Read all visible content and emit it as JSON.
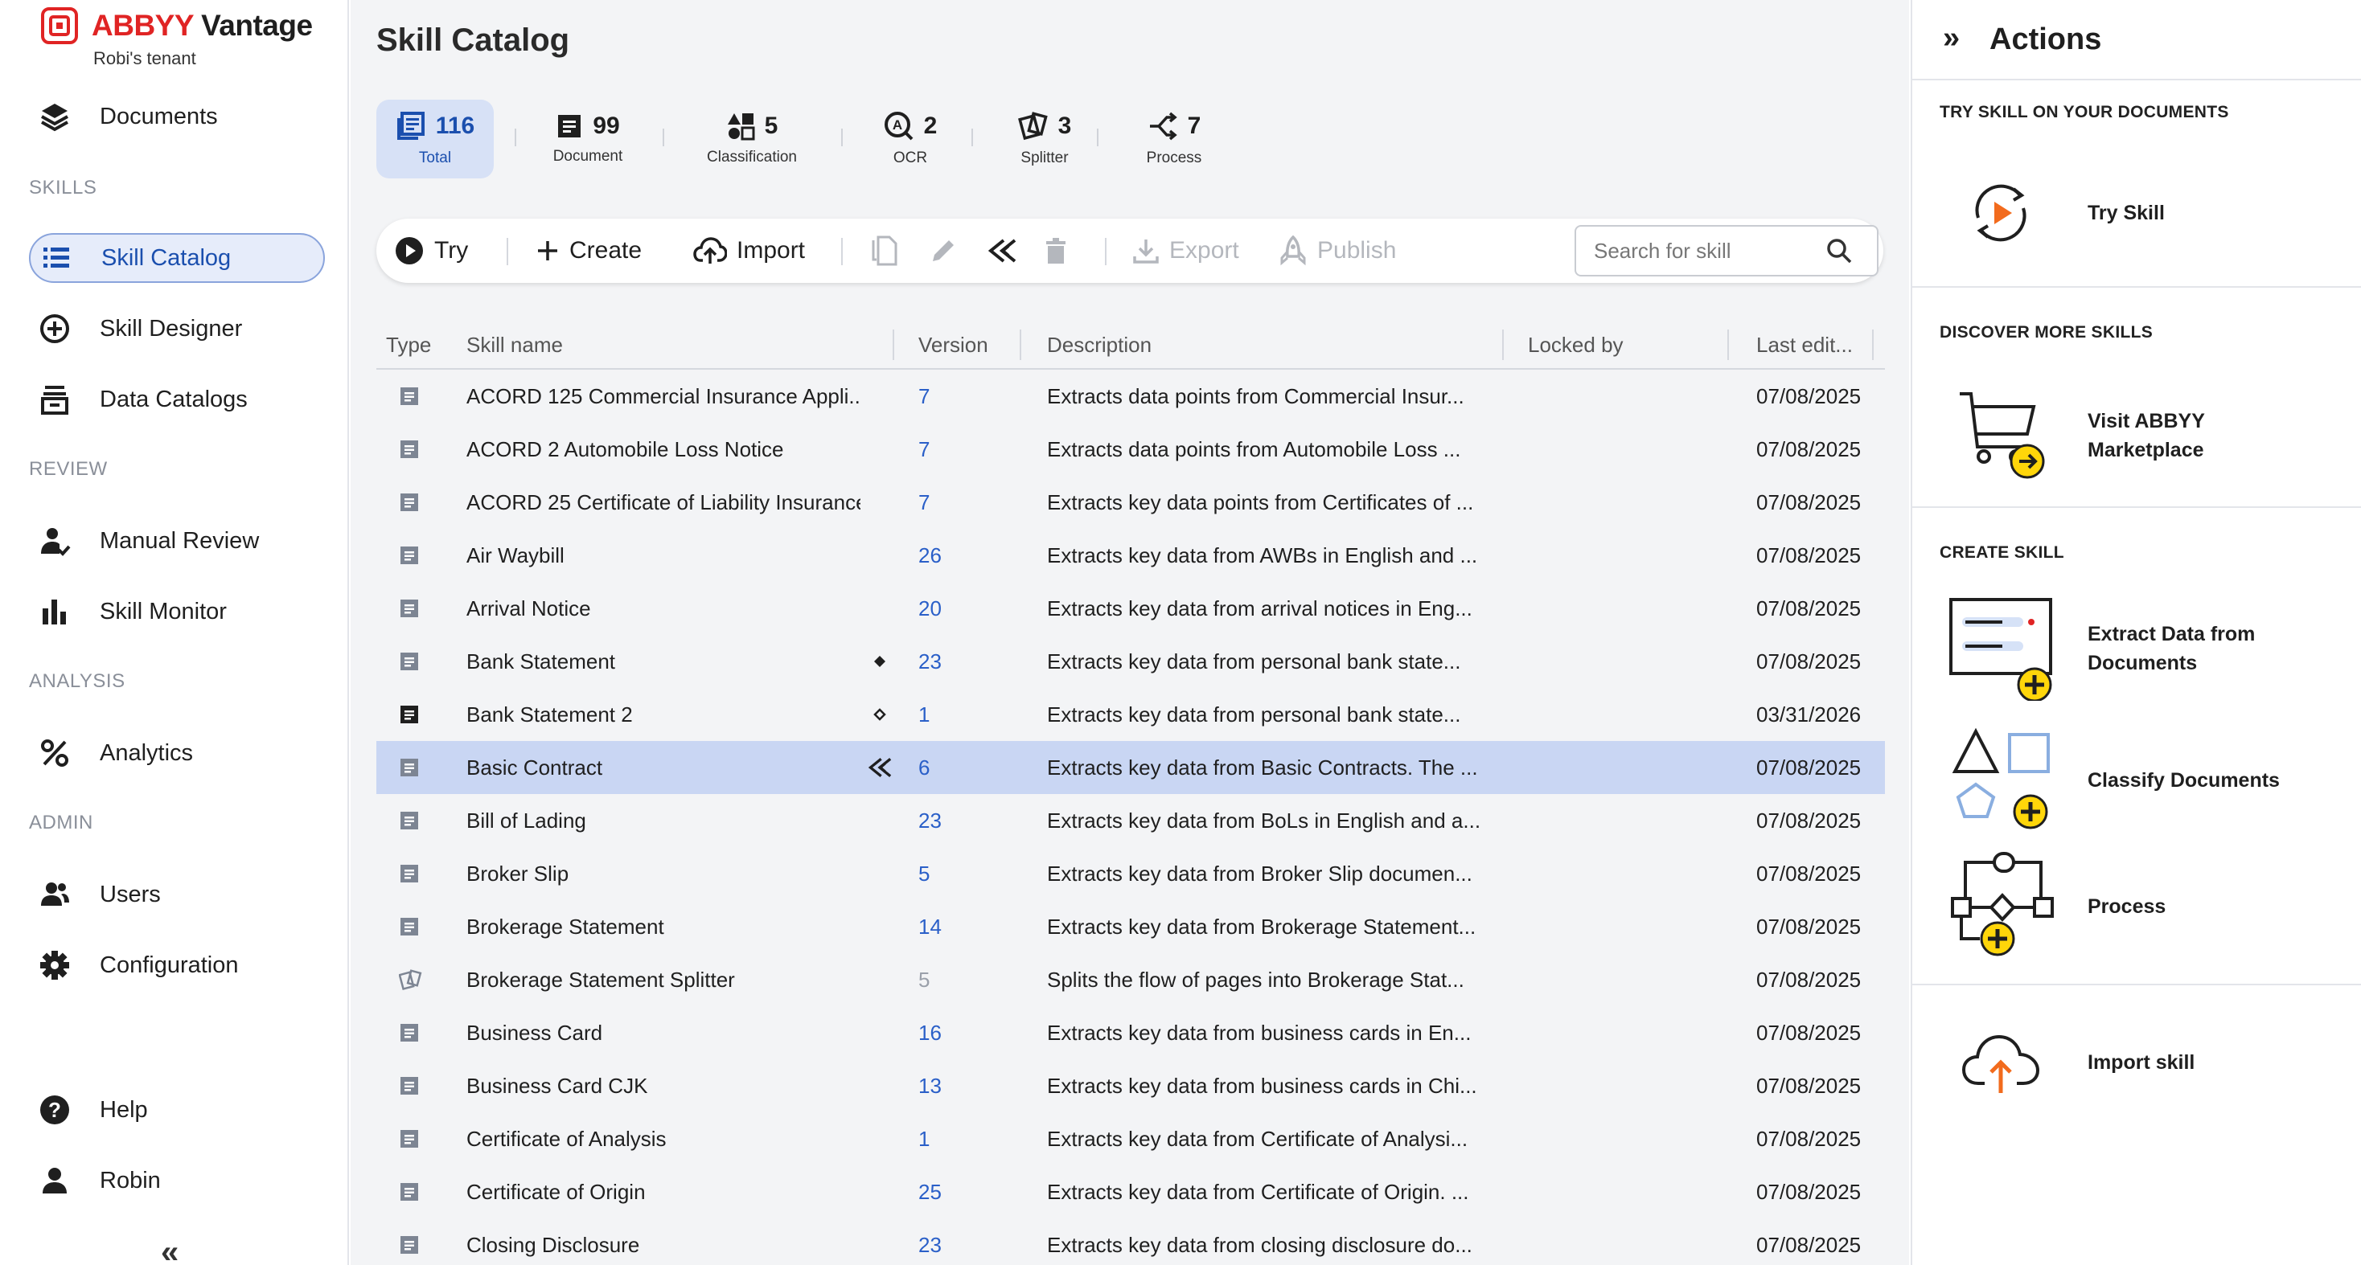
{
  "app": {
    "brand_part1": "ABBYY",
    "brand_part2": " Vantage",
    "tenant": "Robi's tenant",
    "brand_color": "#e02424",
    "accent_color": "#1b4fae"
  },
  "sidebar": {
    "documents": "Documents",
    "skills_section": "SKILLS",
    "skill_catalog": "Skill Catalog",
    "skill_designer": "Skill Designer",
    "data_catalogs": "Data Catalogs",
    "review_section": "REVIEW",
    "manual_review": "Manual Review",
    "skill_monitor": "Skill Monitor",
    "analysis_section": "ANALYSIS",
    "analytics": "Analytics",
    "admin_section": "ADMIN",
    "users": "Users",
    "configuration": "Configuration",
    "help": "Help",
    "user": "Robin",
    "collapse": "«"
  },
  "main": {
    "title": "Skill Catalog",
    "stats": [
      {
        "count": "116",
        "label": "Total",
        "icon": "catalog-icon"
      },
      {
        "count": "99",
        "label": "Document",
        "icon": "document-icon"
      },
      {
        "count": "5",
        "label": "Classification",
        "icon": "classification-icon"
      },
      {
        "count": "2",
        "label": "OCR",
        "icon": "ocr-icon"
      },
      {
        "count": "3",
        "label": "Splitter",
        "icon": "splitter-icon"
      },
      {
        "count": "7",
        "label": "Process",
        "icon": "process-icon"
      }
    ],
    "toolbar": {
      "try": "Try",
      "create": "Create",
      "import": "Import",
      "export": "Export",
      "publish": "Publish",
      "search_placeholder": "Search for skill"
    },
    "columns": {
      "type": "Type",
      "name": "Skill name",
      "version": "Version",
      "description": "Description",
      "locked_by": "Locked by",
      "last_edit": "Last edit..."
    },
    "rows": [
      {
        "type": "document",
        "name": "ACORD 125 Commercial Insurance Appli...",
        "mark": "",
        "version": "7",
        "description": "Extracts data points from Commercial Insur...",
        "date": "07/08/2025"
      },
      {
        "type": "document",
        "name": "ACORD 2 Automobile Loss Notice",
        "mark": "",
        "version": "7",
        "description": "Extracts data points from Automobile Loss ...",
        "date": "07/08/2025"
      },
      {
        "type": "document",
        "name": "ACORD 25 Certificate of Liability Insurance",
        "mark": "",
        "version": "7",
        "description": "Extracts key data points from Certificates of ...",
        "date": "07/08/2025"
      },
      {
        "type": "document",
        "name": "Air Waybill",
        "mark": "",
        "version": "26",
        "description": "Extracts key data from AWBs in English and ...",
        "date": "07/08/2025"
      },
      {
        "type": "document",
        "name": "Arrival Notice",
        "mark": "",
        "version": "20",
        "description": "Extracts key data from arrival notices in Eng...",
        "date": "07/08/2025"
      },
      {
        "type": "document",
        "name": "Bank Statement",
        "mark": "diamond-filled",
        "version": "23",
        "description": "Extracts key data from personal bank state...",
        "date": "07/08/2025"
      },
      {
        "type": "document-dark",
        "name": "Bank Statement 2",
        "mark": "diamond-outline",
        "version": "1",
        "description": "Extracts key data from personal bank state...",
        "date": "03/31/2026"
      },
      {
        "type": "document",
        "name": "Basic Contract",
        "mark": "publish-check",
        "version": "6",
        "description": "Extracts key data from Basic Contracts. The ...",
        "date": "07/08/2025",
        "selected": true
      },
      {
        "type": "document",
        "name": "Bill of Lading",
        "mark": "",
        "version": "23",
        "description": "Extracts key data from BoLs in English and a...",
        "date": "07/08/2025"
      },
      {
        "type": "document",
        "name": "Broker Slip",
        "mark": "",
        "version": "5",
        "description": "Extracts key data from Broker Slip documen...",
        "date": "07/08/2025"
      },
      {
        "type": "document",
        "name": "Brokerage Statement",
        "mark": "",
        "version": "14",
        "description": "Extracts key data from Brokerage Statement...",
        "date": "07/08/2025"
      },
      {
        "type": "splitter",
        "name": "Brokerage Statement Splitter",
        "mark": "",
        "version": "5",
        "version_muted": true,
        "description": "Splits the flow of pages into Brokerage Stat...",
        "date": "07/08/2025"
      },
      {
        "type": "document",
        "name": "Business Card",
        "mark": "",
        "version": "16",
        "description": "Extracts key data from business cards in En...",
        "date": "07/08/2025"
      },
      {
        "type": "document",
        "name": "Business Card CJK",
        "mark": "",
        "version": "13",
        "description": "Extracts key data from business cards in Chi...",
        "date": "07/08/2025"
      },
      {
        "type": "document",
        "name": "Certificate of Analysis",
        "mark": "",
        "version": "1",
        "description": "Extracts key data from Certificate of Analysi...",
        "date": "07/08/2025"
      },
      {
        "type": "document",
        "name": "Certificate of Origin",
        "mark": "",
        "version": "25",
        "description": "Extracts key data from Certificate of Origin. ...",
        "date": "07/08/2025"
      },
      {
        "type": "document",
        "name": "Closing Disclosure",
        "mark": "",
        "version": "23",
        "description": "Extracts key data from closing disclosure do...",
        "date": "07/08/2025"
      }
    ]
  },
  "actions": {
    "title": "Actions",
    "collapse": "»",
    "try_section": "TRY SKILL ON YOUR DOCUMENTS",
    "try_skill": "Try Skill",
    "discover_section": "DISCOVER MORE SKILLS",
    "marketplace": "Visit ABBYY\nMarketplace",
    "create_section": "CREATE SKILL",
    "extract": "Extract Data from\nDocuments",
    "classify": "Classify Documents",
    "process": "Process",
    "import": "Import skill"
  }
}
